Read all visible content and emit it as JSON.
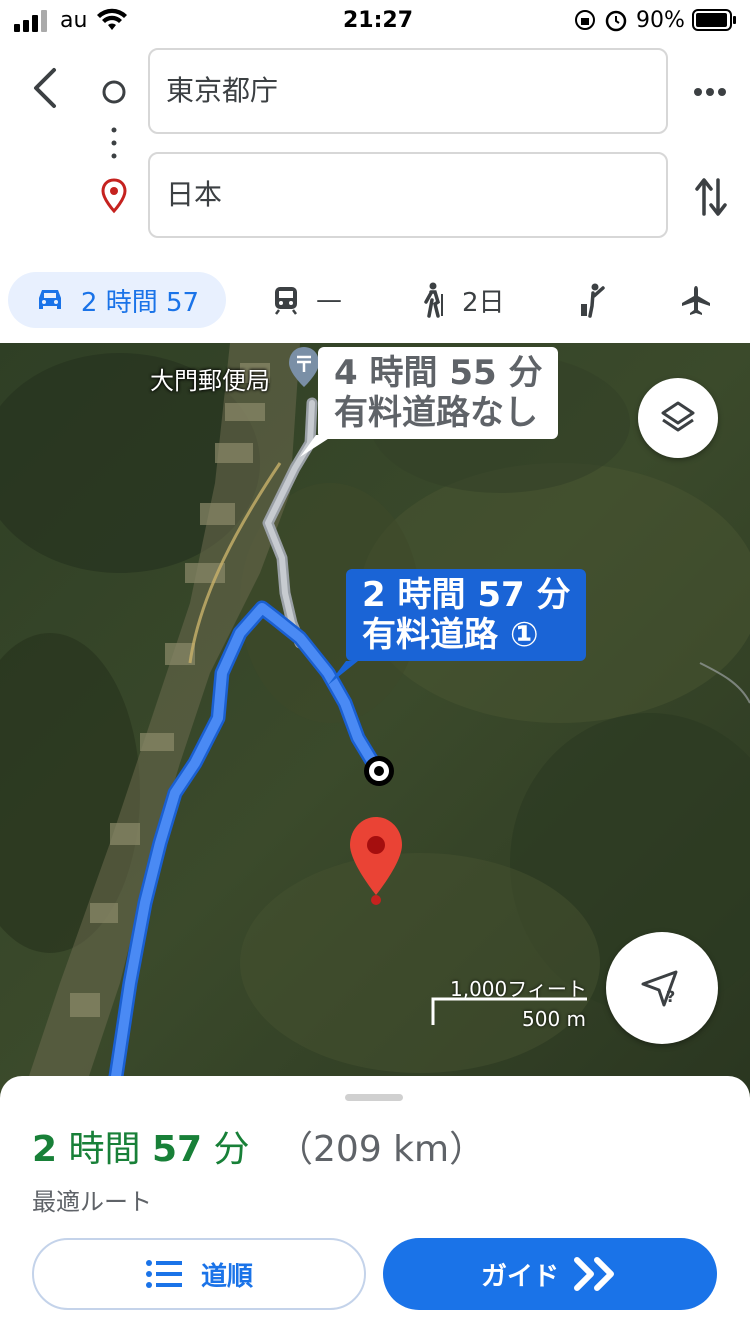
{
  "status_bar": {
    "carrier": "au",
    "time": "21:27",
    "battery": "90%"
  },
  "header": {
    "origin": "東京都庁",
    "destination": "日本"
  },
  "modes": {
    "car": "2 時間 57",
    "transit": "—",
    "walk": "2日"
  },
  "map": {
    "poi_label": "大門郵便局",
    "alt_route": {
      "duration": "4 時間 55 分",
      "note": "有料道路なし"
    },
    "main_route": {
      "duration": "2 時間 57 分",
      "note": "有料道路 ①"
    },
    "scale": {
      "feet": "1,000フィート",
      "meters": "500 m"
    }
  },
  "summary": {
    "hours": "2",
    "hours_unit": "時間",
    "minutes": "57",
    "minutes_unit": "分",
    "distance": "（209 km）",
    "subtitle": "最適ルート"
  },
  "buttons": {
    "steps": "道順",
    "guide": "ガイド"
  },
  "colors": {
    "accent": "#1a73e8",
    "route": "#4285f4",
    "time_green": "#188038",
    "pin": "#ea4335"
  }
}
